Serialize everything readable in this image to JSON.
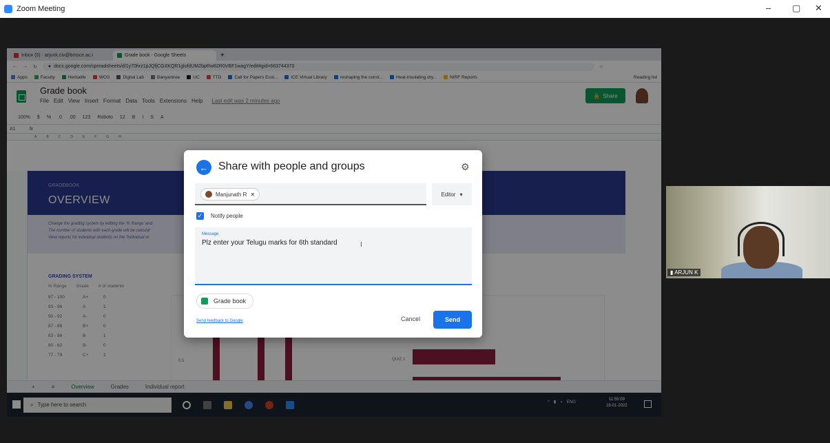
{
  "zoom": {
    "window_title": "Zoom Meeting",
    "minimize": "–",
    "restore": "▢",
    "close": "✕"
  },
  "browser": {
    "tabs": [
      {
        "label": "Inbox (5) · arjunk.civ@bmsce.ac.i",
        "favicon_color": "#d93025"
      },
      {
        "label": "Grade book - Google Sheets",
        "favicon_color": "#0f9d58"
      }
    ],
    "new_tab": "+",
    "url": "docs.google.com/spreadsheets/d/1y70hrz1pJQfjCGXKQR1glofdUM2bpRw82R0VBF1wagY/edit#gid=663744370",
    "bookmarks": [
      {
        "label": "Apps",
        "color": "#4285f4"
      },
      {
        "label": "Faculty",
        "color": "#34a853"
      },
      {
        "label": "Herbalife",
        "color": "#0f9d58"
      },
      {
        "label": "WOS",
        "color": "#ea4335"
      },
      {
        "label": "Digital Lab",
        "color": "#555555"
      },
      {
        "label": "Banyantree",
        "color": "#777777"
      },
      {
        "label": "UC",
        "color": "#1a1a1a"
      },
      {
        "label": "TTD",
        "color": "#ea4335"
      },
      {
        "label": "Call for Papers Ecol...",
        "color": "#1a73e8"
      },
      {
        "label": "ICE Virtual Library",
        "color": "#1a73e8"
      },
      {
        "label": "reshaping the const...",
        "color": "#1a73e8"
      },
      {
        "label": "Heat-insulating dry...",
        "color": "#1a73e8"
      },
      {
        "label": "NIRF Reports",
        "color": "#fbbc04"
      }
    ],
    "reading_list": "Reading list"
  },
  "sheets": {
    "title": "Grade book",
    "menus": [
      "File",
      "Edit",
      "View",
      "Insert",
      "Format",
      "Data",
      "Tools",
      "Extensions",
      "Help"
    ],
    "last_edit": "Last edit was 2 minutes ago",
    "share": "Share",
    "toolbar": [
      "100%",
      "$",
      "%",
      ".0",
      ".00",
      "123",
      "Roboto",
      "12",
      "B",
      "I",
      "S",
      "A"
    ],
    "cell_ref": "A1",
    "fx": "fx",
    "banner_small": "GRADEBOOK",
    "banner_big": "OVERVIEW",
    "desc_lines": [
      "Change the grading system by editing the '% Range' and",
      "The number of students with each grade will be calculat",
      "View reports for individual students on the 'Individual re"
    ],
    "grading_title": "GRADING SYSTEM",
    "grading_head": [
      "% Range",
      "Grade",
      "# of students"
    ],
    "grading_rows": [
      [
        "97 - 100",
        "A+",
        "0"
      ],
      [
        "93 - 96",
        "A",
        "1"
      ],
      [
        "90 - 92",
        "A-",
        "0"
      ],
      [
        "87 - 89",
        "B+",
        "0"
      ],
      [
        "83 - 86",
        "B",
        "1"
      ],
      [
        "80 - 82",
        "B-",
        "0"
      ],
      [
        "77 - 79",
        "C+",
        "1"
      ]
    ],
    "chart_tick": "0.5",
    "chart_label": "QUIZ 1",
    "sheet_tabs": [
      "Overview",
      "Grades",
      "Individual report"
    ]
  },
  "taskbar": {
    "search_placeholder": "Type here to search",
    "lang": "ENG",
    "time": "11:55:09",
    "date": "18-01-2022"
  },
  "dialog": {
    "title": "Share with people and groups",
    "chip_name": "Manjunath R",
    "role": "Editor",
    "notify_label": "Notify people",
    "message_label": "Message",
    "message_text": "Plz enter your Telugu marks for 6th standard",
    "file_name": "Grade book",
    "feedback": "Send feedback to Google",
    "cancel": "Cancel",
    "send": "Send"
  },
  "video": {
    "participant": "ARJUN K"
  }
}
